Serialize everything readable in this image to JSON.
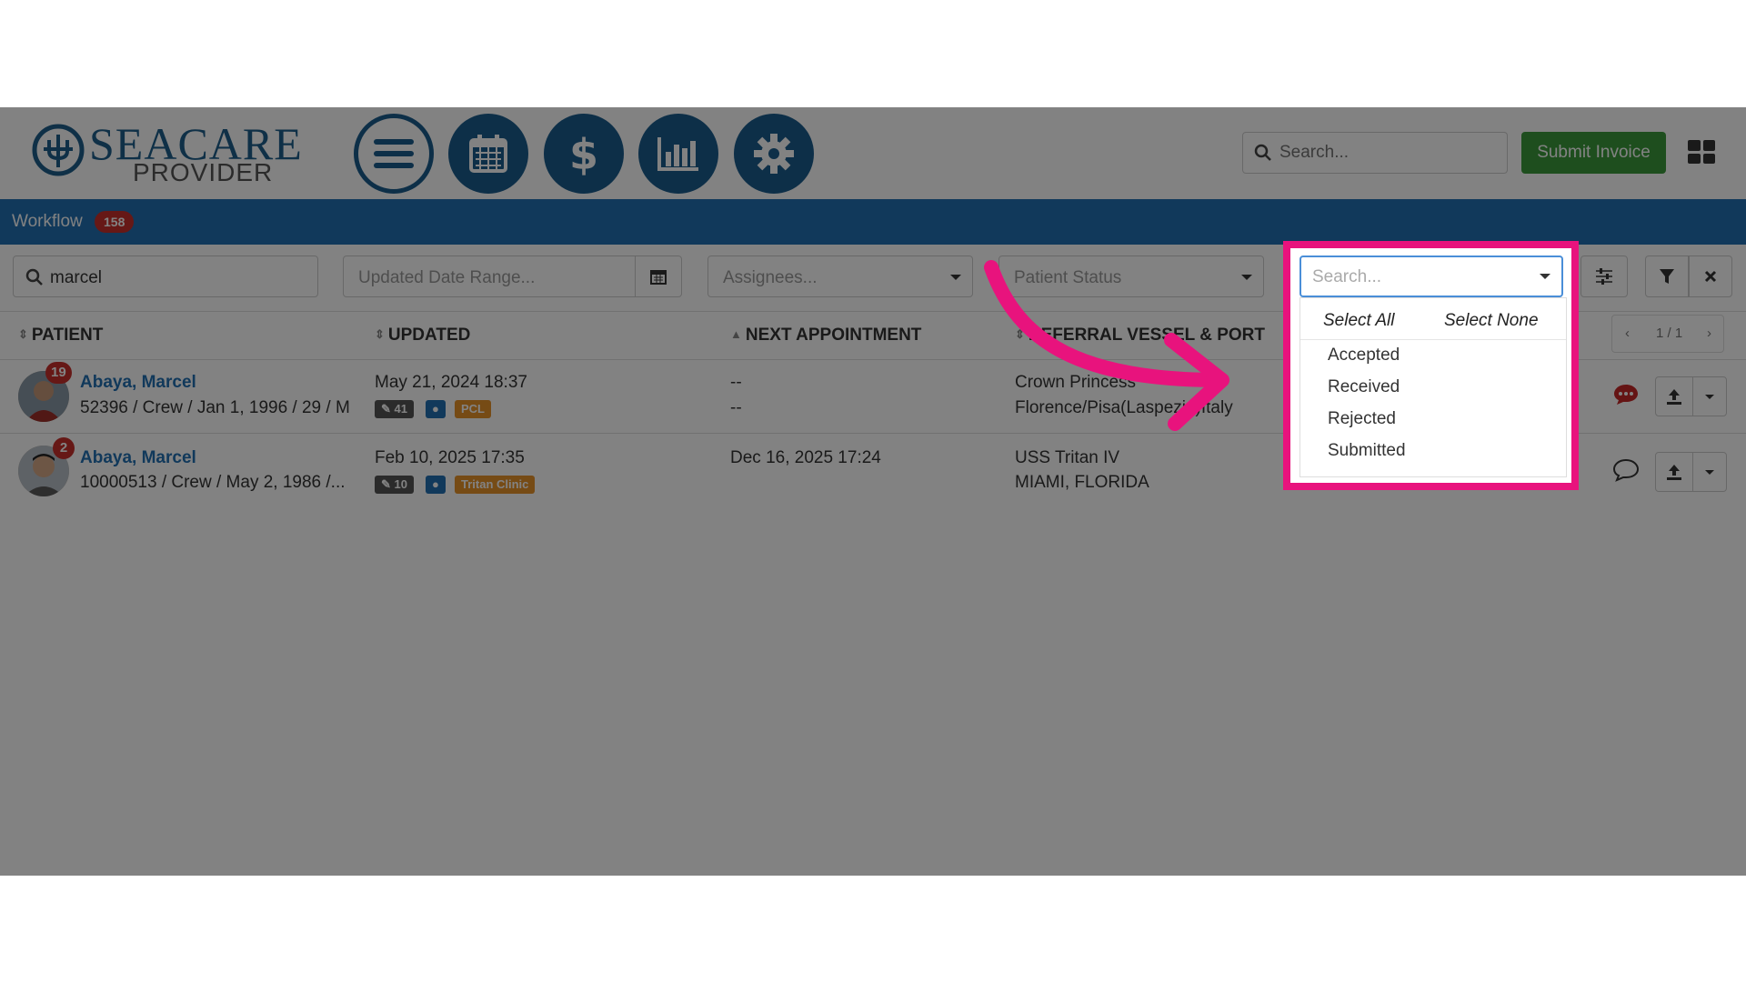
{
  "header": {
    "logo_main": "SEACARE",
    "logo_sub": "PROVIDER",
    "nav_icons": [
      "menu-icon",
      "calendar-icon",
      "dollar-icon",
      "bar-chart-icon",
      "gear-icon"
    ],
    "search_placeholder": "Search...",
    "submit_label": "Submit Invoice"
  },
  "workflow": {
    "label": "Workflow",
    "count": "158"
  },
  "filters": {
    "patient_search_value": "marcel",
    "date_range_placeholder": "Updated Date Range...",
    "assignees_placeholder": "Assignees...",
    "patient_status_placeholder": "Patient Status"
  },
  "status_dropdown": {
    "placeholder": "Search...",
    "select_all": "Select All",
    "select_none": "Select None",
    "options": [
      "Accepted",
      "Received",
      "Rejected",
      "Submitted"
    ]
  },
  "table": {
    "columns": [
      "PATIENT",
      "UPDATED",
      "NEXT APPOINTMENT",
      "REFERRAL VESSEL & PORT"
    ],
    "pager": "1 / 1",
    "rows": [
      {
        "badge": "19",
        "name": "Abaya, Marcel",
        "details": "52396 / Crew / Jan 1, 1996 / 29 / M",
        "updated": "May 21, 2024 18:37",
        "attachments": "41",
        "tag": "PCL",
        "next_line1": "--",
        "next_line2": "--",
        "vessel": "Crown Princess",
        "port": "Florence/Pisa(Laspezia)Italy"
      },
      {
        "badge": "2",
        "name": "Abaya, Marcel",
        "details": "10000513 / Crew / May 2, 1986 /...",
        "updated": "Feb 10, 2025 17:35",
        "attachments": "10",
        "tag": "Tritan Clinic",
        "next_line1": "Dec 16, 2025 17:24",
        "next_line2": "",
        "vessel": "USS Tritan IV",
        "port": "MIAMI, FLORIDA"
      }
    ]
  },
  "colors": {
    "brand": "#1a5d8e",
    "highlight": "#e8137d",
    "success": "#3c9a3c",
    "badge": "#c9302c"
  }
}
